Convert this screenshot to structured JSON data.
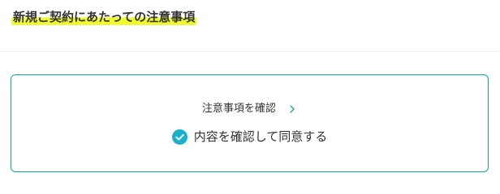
{
  "header": {
    "title": "新規ご契約にあたっての注意事項"
  },
  "notice": {
    "confirm_link_label": "注意事項を確認",
    "agree_label": "内容を確認して同意する",
    "agree_checked": true
  },
  "colors": {
    "accent": "#13a89c",
    "check": "#1ab0cc",
    "highlight": "#f1fb2b",
    "text": "#333333"
  },
  "icons": {
    "link_arrow": "chevron-right-icon",
    "checkbox": "check-circle-icon"
  }
}
